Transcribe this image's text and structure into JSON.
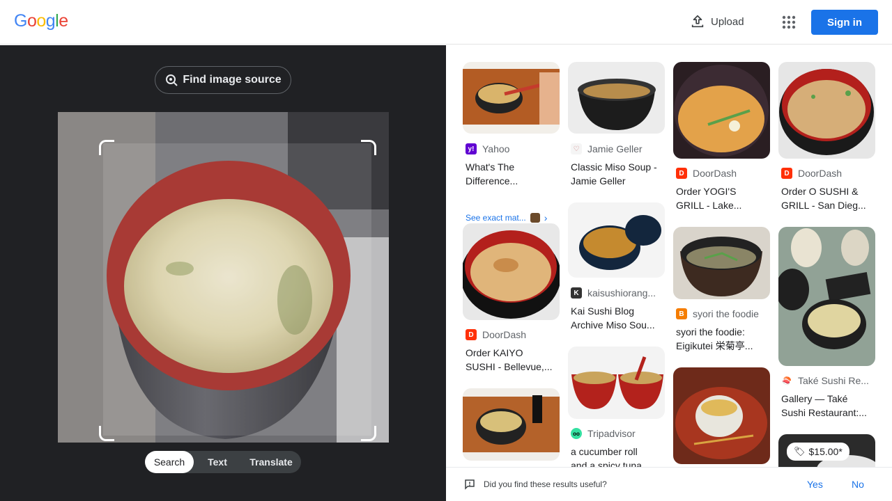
{
  "header": {
    "logo": [
      "G",
      "o",
      "o",
      "g",
      "l",
      "e"
    ],
    "logo_colors": [
      "#4285F4",
      "#EA4335",
      "#FBBC05",
      "#4285F4",
      "#34A853",
      "#EA4335"
    ],
    "upload_label": "Upload",
    "signin_label": "Sign in"
  },
  "lens": {
    "find_source_label": "Find image source",
    "tabs": [
      "Search",
      "Text",
      "Translate"
    ],
    "active_tab": "Search"
  },
  "results": [
    {
      "source": "Yahoo",
      "title1": "What's The",
      "title2": "Difference...",
      "icon_color": "#6001d2",
      "icon": "y!",
      "exact": "See exact mat..."
    },
    {
      "source": "Jamie Geller",
      "title1": "Classic Miso Soup -",
      "title2": "Jamie Geller",
      "icon_color": "#e0e0e0",
      "icon": "♡"
    },
    {
      "source": "DoorDash",
      "title1": "Order YOGI'S",
      "title2": "GRILL - Lake...",
      "icon_color": "#ff3008",
      "icon": "D"
    },
    {
      "source": "DoorDash",
      "title1": "Order O SUSHI  &",
      "title2": "GRILL - San Dieg...",
      "icon_color": "#ff3008",
      "icon": "D"
    },
    {
      "source": "DoorDash",
      "title1": "Order KAIYO",
      "title2": "SUSHI - Bellevue,...",
      "icon_color": "#ff3008",
      "icon": "D"
    },
    {
      "source": "kaisushiorang...",
      "title1": "Kai Sushi Blog",
      "title2": "Archive Miso Sou...",
      "icon_color": "#333333",
      "icon": "K"
    },
    {
      "source": "syori the foodie",
      "title1": "syori the foodie:",
      "title2": "Eigikutei 栄菊亭...",
      "icon_color": "#f57d00",
      "icon": "B"
    },
    {
      "source": "Také Sushi Re...",
      "title1": "Gallery — Také",
      "title2": "Sushi Restaurant:...",
      "icon_color": "#e8eaed",
      "icon": "🍣"
    },
    {
      "source": "Tripadvisor",
      "title1": "a cucumber roll",
      "title2": "and a spicy tuna",
      "icon_color": "#34e0a1",
      "icon": "oo"
    }
  ],
  "price_tag": "$15.00*",
  "feedback": {
    "question": "Did you find these results useful?",
    "yes": "Yes",
    "no": "No"
  }
}
